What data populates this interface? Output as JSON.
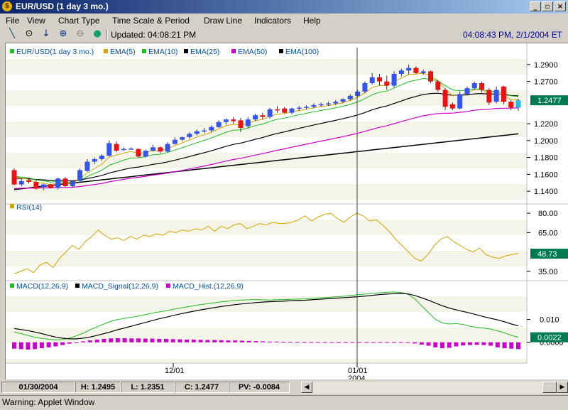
{
  "window": {
    "title": "EUR/USD (1 day  3 mo.)",
    "app_icon": "dollar-icon",
    "controls": [
      "minimize-icon",
      "restore-icon",
      "close-icon"
    ]
  },
  "menu": [
    "File",
    "View",
    "Chart Type",
    "Time Scale & Period",
    "Draw Line",
    "Indicators",
    "Help"
  ],
  "toolbar": {
    "icons": [
      "draw-line-icon",
      "crosshair-icon",
      "down-arrow-icon",
      "zoom-in-icon",
      "zoom-out-icon",
      "refresh-icon"
    ],
    "updated": "Updated: 04:08:21 PM",
    "clock": "04:08:43 PM, 2/1/2004 ET"
  },
  "colors": {
    "up_candle": "#3355ee",
    "down_candle": "#ee1111",
    "last_candle": "#22bbee",
    "ema5": "#d4a400",
    "ema10": "#22bb22",
    "ema25": "#000000",
    "ema50": "#cc00cc",
    "ema100": "#000000",
    "rsi": "#d4a400",
    "macd": "#22bb22",
    "signal": "#000000",
    "hist": "#cc00cc",
    "price_badge": "#007a50"
  },
  "chart_data": [
    {
      "type": "candlestick",
      "legend": [
        "EUR/USD(1 day  3 mo.)",
        "EMA(5)",
        "EMA(10)",
        "EMA(25)",
        "EMA(50)",
        "EMA(100)"
      ],
      "yticks": [
        "1.2900",
        "1.2700",
        "1.2477",
        "1.2200",
        "1.2000",
        "1.1800",
        "1.1600",
        "1.1400"
      ],
      "ylim": [
        1.13,
        1.3
      ],
      "last_price": "1.2477",
      "candles": [
        {
          "o": 1.165,
          "h": 1.167,
          "l": 1.147,
          "c": 1.148
        },
        {
          "o": 1.148,
          "h": 1.155,
          "l": 1.146,
          "c": 1.152
        },
        {
          "o": 1.153,
          "h": 1.156,
          "l": 1.149,
          "c": 1.151
        },
        {
          "o": 1.151,
          "h": 1.153,
          "l": 1.142,
          "c": 1.143
        },
        {
          "o": 1.145,
          "h": 1.149,
          "l": 1.141,
          "c": 1.148
        },
        {
          "o": 1.148,
          "h": 1.149,
          "l": 1.143,
          "c": 1.144
        },
        {
          "o": 1.144,
          "h": 1.156,
          "l": 1.142,
          "c": 1.155
        },
        {
          "o": 1.155,
          "h": 1.157,
          "l": 1.145,
          "c": 1.146
        },
        {
          "o": 1.146,
          "h": 1.153,
          "l": 1.144,
          "c": 1.152
        },
        {
          "o": 1.152,
          "h": 1.167,
          "l": 1.15,
          "c": 1.165
        },
        {
          "o": 1.164,
          "h": 1.178,
          "l": 1.163,
          "c": 1.175
        },
        {
          "o": 1.175,
          "h": 1.18,
          "l": 1.172,
          "c": 1.178
        },
        {
          "o": 1.178,
          "h": 1.184,
          "l": 1.176,
          "c": 1.182
        },
        {
          "o": 1.182,
          "h": 1.2,
          "l": 1.181,
          "c": 1.197
        },
        {
          "o": 1.196,
          "h": 1.199,
          "l": 1.186,
          "c": 1.188
        },
        {
          "o": 1.189,
          "h": 1.192,
          "l": 1.188,
          "c": 1.19
        },
        {
          "o": 1.19,
          "h": 1.192,
          "l": 1.189,
          "c": 1.1905
        },
        {
          "o": 1.19,
          "h": 1.191,
          "l": 1.18,
          "c": 1.181
        },
        {
          "o": 1.181,
          "h": 1.189,
          "l": 1.18,
          "c": 1.188
        },
        {
          "o": 1.188,
          "h": 1.195,
          "l": 1.187,
          "c": 1.192
        },
        {
          "o": 1.192,
          "h": 1.193,
          "l": 1.185,
          "c": 1.187
        },
        {
          "o": 1.187,
          "h": 1.198,
          "l": 1.186,
          "c": 1.196
        },
        {
          "o": 1.196,
          "h": 1.204,
          "l": 1.195,
          "c": 1.201
        },
        {
          "o": 1.201,
          "h": 1.205,
          "l": 1.199,
          "c": 1.204
        },
        {
          "o": 1.204,
          "h": 1.21,
          "l": 1.202,
          "c": 1.208
        },
        {
          "o": 1.208,
          "h": 1.213,
          "l": 1.206,
          "c": 1.211
        },
        {
          "o": 1.211,
          "h": 1.215,
          "l": 1.209,
          "c": 1.212
        },
        {
          "o": 1.212,
          "h": 1.218,
          "l": 1.21,
          "c": 1.216
        },
        {
          "o": 1.216,
          "h": 1.224,
          "l": 1.215,
          "c": 1.222
        },
        {
          "o": 1.222,
          "h": 1.226,
          "l": 1.219,
          "c": 1.225
        },
        {
          "o": 1.225,
          "h": 1.228,
          "l": 1.22,
          "c": 1.223
        },
        {
          "o": 1.224,
          "h": 1.227,
          "l": 1.21,
          "c": 1.215
        },
        {
          "o": 1.217,
          "h": 1.228,
          "l": 1.215,
          "c": 1.225
        },
        {
          "o": 1.225,
          "h": 1.232,
          "l": 1.223,
          "c": 1.23
        },
        {
          "o": 1.23,
          "h": 1.233,
          "l": 1.225,
          "c": 1.228
        },
        {
          "o": 1.228,
          "h": 1.239,
          "l": 1.226,
          "c": 1.237
        },
        {
          "o": 1.237,
          "h": 1.241,
          "l": 1.233,
          "c": 1.236
        },
        {
          "o": 1.238,
          "h": 1.24,
          "l": 1.232,
          "c": 1.233
        },
        {
          "o": 1.233,
          "h": 1.239,
          "l": 1.231,
          "c": 1.238
        },
        {
          "o": 1.238,
          "h": 1.241,
          "l": 1.235,
          "c": 1.239
        },
        {
          "o": 1.239,
          "h": 1.242,
          "l": 1.237,
          "c": 1.24
        },
        {
          "o": 1.24,
          "h": 1.244,
          "l": 1.238,
          "c": 1.242
        },
        {
          "o": 1.242,
          "h": 1.245,
          "l": 1.24,
          "c": 1.243
        },
        {
          "o": 1.243,
          "h": 1.246,
          "l": 1.241,
          "c": 1.244
        },
        {
          "o": 1.244,
          "h": 1.248,
          "l": 1.242,
          "c": 1.246
        },
        {
          "o": 1.246,
          "h": 1.25,
          "l": 1.244,
          "c": 1.249
        },
        {
          "o": 1.249,
          "h": 1.255,
          "l": 1.247,
          "c": 1.253
        },
        {
          "o": 1.253,
          "h": 1.26,
          "l": 1.251,
          "c": 1.258
        },
        {
          "o": 1.258,
          "h": 1.27,
          "l": 1.256,
          "c": 1.268
        },
        {
          "o": 1.268,
          "h": 1.28,
          "l": 1.266,
          "c": 1.275
        },
        {
          "o": 1.275,
          "h": 1.279,
          "l": 1.265,
          "c": 1.27
        },
        {
          "o": 1.27,
          "h": 1.277,
          "l": 1.26,
          "c": 1.265
        },
        {
          "o": 1.265,
          "h": 1.282,
          "l": 1.263,
          "c": 1.279
        },
        {
          "o": 1.279,
          "h": 1.285,
          "l": 1.276,
          "c": 1.283
        },
        {
          "o": 1.283,
          "h": 1.29,
          "l": 1.278,
          "c": 1.286
        },
        {
          "o": 1.286,
          "h": 1.288,
          "l": 1.279,
          "c": 1.28
        },
        {
          "o": 1.28,
          "h": 1.284,
          "l": 1.278,
          "c": 1.282
        },
        {
          "o": 1.282,
          "h": 1.283,
          "l": 1.268,
          "c": 1.27
        },
        {
          "o": 1.27,
          "h": 1.272,
          "l": 1.258,
          "c": 1.26
        },
        {
          "o": 1.26,
          "h": 1.262,
          "l": 1.236,
          "c": 1.24
        },
        {
          "o": 1.243,
          "h": 1.245,
          "l": 1.236,
          "c": 1.238
        },
        {
          "o": 1.238,
          "h": 1.258,
          "l": 1.237,
          "c": 1.255
        },
        {
          "o": 1.255,
          "h": 1.264,
          "l": 1.253,
          "c": 1.262
        },
        {
          "o": 1.262,
          "h": 1.27,
          "l": 1.26,
          "c": 1.268
        },
        {
          "o": 1.268,
          "h": 1.27,
          "l": 1.257,
          "c": 1.26
        },
        {
          "o": 1.26,
          "h": 1.262,
          "l": 1.242,
          "c": 1.245
        },
        {
          "o": 1.246,
          "h": 1.264,
          "l": 1.244,
          "c": 1.26
        },
        {
          "o": 1.264,
          "h": 1.265,
          "l": 1.243,
          "c": 1.246
        },
        {
          "o": 1.246,
          "h": 1.248,
          "l": 1.236,
          "c": 1.239
        },
        {
          "o": 1.239,
          "h": 1.2495,
          "l": 1.2351,
          "c": 1.2477
        }
      ]
    },
    {
      "type": "line",
      "legend": [
        "RSI(14)"
      ],
      "yticks": [
        "80.00",
        "65.00",
        "48.73",
        "35.00"
      ],
      "ylim": [
        30,
        85
      ],
      "last_value": "48.73",
      "values": [
        33,
        35,
        37,
        34,
        40,
        42,
        38,
        45,
        50,
        55,
        52,
        58,
        62,
        67,
        63,
        60,
        61,
        59,
        62,
        60,
        63,
        62,
        64,
        63,
        66,
        65,
        67,
        66,
        68,
        67,
        70,
        66,
        70,
        68,
        71,
        72,
        68,
        70,
        72,
        71,
        73,
        72,
        72,
        73,
        75,
        78,
        74,
        77,
        79,
        80,
        76,
        73,
        77,
        80,
        78,
        74,
        75,
        71,
        66,
        60,
        55,
        50,
        45,
        43,
        48,
        55,
        60,
        62,
        58,
        55,
        52,
        50,
        53,
        48,
        46,
        45,
        47,
        48,
        49
      ]
    },
    {
      "type": "bar",
      "legend": [
        "MACD(12,26,9)",
        "MACD_Signal(12,26,9)",
        "MACD_Hist.(12,26,9)"
      ],
      "yticks": [
        "0.010",
        "0.0022",
        "0.0000"
      ],
      "ylim": [
        -0.006,
        0.022
      ],
      "last_value": "0.0022",
      "x_labels": [
        "12/01",
        "01/01",
        "2004"
      ],
      "macd": [
        0.0045,
        0.0038,
        0.003,
        0.0022,
        0.0017,
        0.0013,
        0.0011,
        0.0012,
        0.0018,
        0.0028,
        0.004,
        0.0055,
        0.0068,
        0.008,
        0.0092,
        0.01,
        0.0105,
        0.011,
        0.0115,
        0.0121,
        0.0128,
        0.0133,
        0.0138,
        0.0144,
        0.015,
        0.0155,
        0.016,
        0.0165,
        0.0169,
        0.0173,
        0.0177,
        0.018,
        0.0183,
        0.0185,
        0.0186,
        0.0187,
        0.0186,
        0.0185,
        0.0186,
        0.0187,
        0.0188,
        0.0189,
        0.019,
        0.0192,
        0.0194,
        0.0196,
        0.0198,
        0.02,
        0.0203,
        0.0206,
        0.0209,
        0.0212,
        0.0215,
        0.0217,
        0.0219,
        0.022,
        0.0218,
        0.021,
        0.019,
        0.016,
        0.013,
        0.01,
        0.0085,
        0.008,
        0.0082,
        0.0078,
        0.007,
        0.0065,
        0.0062,
        0.0058,
        0.005,
        0.0042,
        0.003,
        0.0022
      ],
      "signal": [
        0.006,
        0.0056,
        0.0051,
        0.0045,
        0.0038,
        0.003,
        0.0023,
        0.0018,
        0.0015,
        0.0015,
        0.0018,
        0.0023,
        0.003,
        0.0038,
        0.0046,
        0.0055,
        0.0063,
        0.0071,
        0.0079,
        0.0087,
        0.0095,
        0.0103,
        0.011,
        0.0117,
        0.0124,
        0.013,
        0.0136,
        0.0142,
        0.0147,
        0.0152,
        0.0157,
        0.0161,
        0.0165,
        0.0168,
        0.0171,
        0.0174,
        0.0176,
        0.0178,
        0.0179,
        0.018,
        0.0182,
        0.0183,
        0.0184,
        0.0186,
        0.0188,
        0.019,
        0.0192,
        0.0194,
        0.0196,
        0.0198,
        0.02,
        0.0203,
        0.0206,
        0.0209,
        0.0211,
        0.0213,
        0.0214,
        0.0212,
        0.0205,
        0.0195,
        0.0184,
        0.0172,
        0.016,
        0.015,
        0.0142,
        0.0135,
        0.0128,
        0.012,
        0.0112,
        0.0105,
        0.0098,
        0.009,
        0.008,
        0.0072
      ],
      "hist": [
        -0.0028,
        -0.003,
        -0.0032,
        -0.003,
        -0.0026,
        -0.0022,
        -0.0018,
        -0.0012,
        -0.0006,
        -0.0002,
        0.0004,
        0.0008,
        0.0012,
        0.0015,
        0.0017,
        0.0018,
        0.0018,
        0.0017,
        0.0017,
        0.0016,
        0.0016,
        0.0015,
        0.0015,
        0.0014,
        0.0013,
        0.0012,
        0.0012,
        0.0011,
        0.001,
        0.001,
        0.0009,
        0.0008,
        0.0008,
        0.0007,
        0.0006,
        0.0005,
        0.0004,
        0.0003,
        0.0003,
        0.0002,
        0.0002,
        0.0002,
        0.0001,
        0.0001,
        0.0001,
        0.0001,
        0.0001,
        0.0001,
        0.0001,
        0.0001,
        0.0001,
        0.0001,
        0.0001,
        0.0001,
        0.0001,
        0.0001,
        0.0001,
        -0.0002,
        -0.0005,
        -0.001,
        -0.0015,
        -0.0022,
        -0.0026,
        -0.0024,
        -0.0018,
        -0.0014,
        -0.0012,
        -0.0011,
        -0.0012,
        -0.0015,
        -0.0022,
        -0.0026,
        -0.0028,
        -0.003
      ]
    }
  ],
  "status": {
    "date": "01/30/2004",
    "high": "H: 1.2495",
    "low": "L: 1.2351",
    "close": "C: 1.2477",
    "pv": "PV: -0.0084"
  },
  "warning": "Warning: Applet Window"
}
